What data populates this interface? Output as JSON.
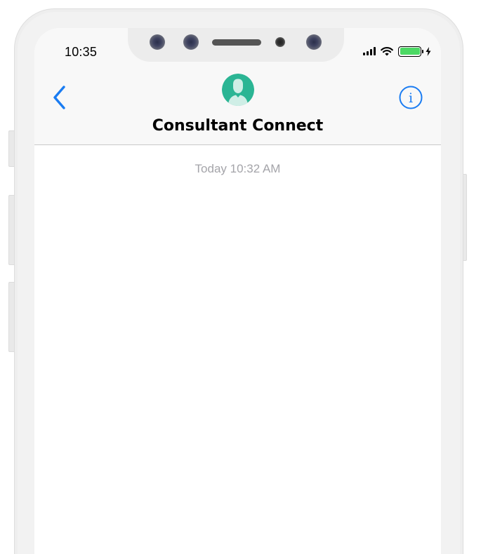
{
  "status_bar": {
    "time": "10:35",
    "signal_icon": "cellular-signal-icon",
    "wifi_icon": "wifi-icon",
    "battery_icon": "battery-icon",
    "charging_icon": "charging-bolt-icon",
    "battery_level": 1.0,
    "battery_color": "#4cd964"
  },
  "nav": {
    "back_icon": "chevron-left-icon",
    "avatar_icon": "person-avatar-icon",
    "avatar_color": "#2bb594",
    "contact_name": "Consultant Connect",
    "info_icon": "info-icon",
    "accent_color": "#1a7cf2"
  },
  "conversation": {
    "timestamp": "Today 10:32 AM"
  }
}
